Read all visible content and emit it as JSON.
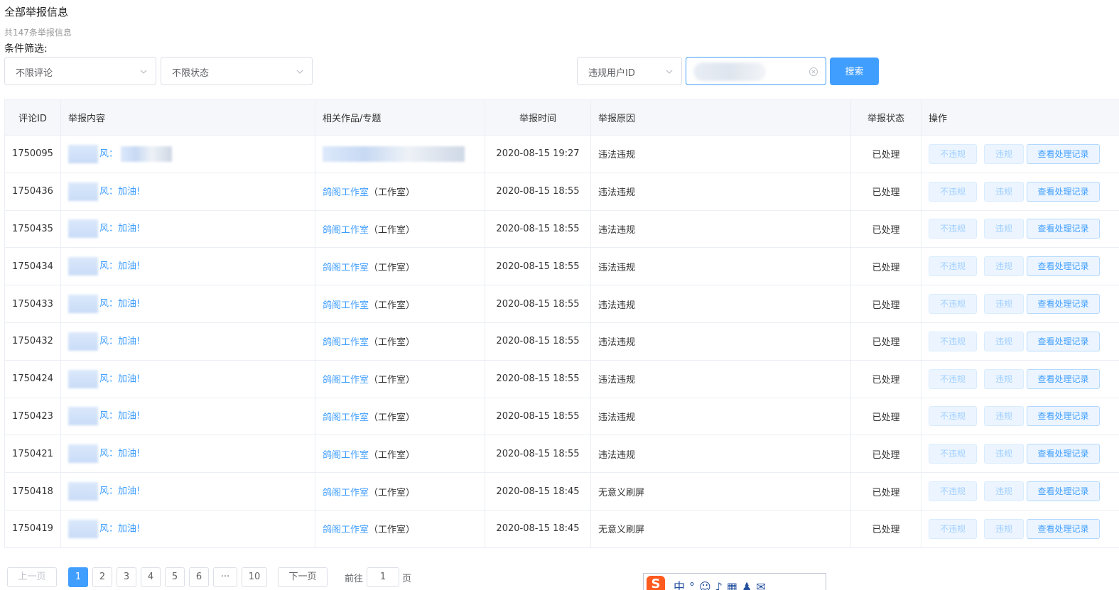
{
  "header": {
    "title": "全部举报信息",
    "count_text": "共147条举报信息",
    "filter_label": "条件筛选:"
  },
  "filters": {
    "comment_select": "不限评论",
    "status_select": "不限状态",
    "field_select": "违规用户ID",
    "search_button": "搜索"
  },
  "table": {
    "columns": [
      "评论ID",
      "举报内容",
      "相关作品/专题",
      "举报时间",
      "举报原因",
      "举报状态",
      "操作"
    ],
    "rows": [
      {
        "id": "1750095",
        "content_suffix": "风：",
        "work": "",
        "work_suffix": "",
        "time": "2020-08-15 19:27",
        "reason": "违法违规",
        "status": "已处理"
      },
      {
        "id": "1750436",
        "content_suffix": "风：加油!",
        "work": "鸽阁工作室",
        "work_suffix": "（工作室）",
        "time": "2020-08-15 18:55",
        "reason": "违法违规",
        "status": "已处理"
      },
      {
        "id": "1750435",
        "content_suffix": "风：加油!",
        "work": "鸽阁工作室",
        "work_suffix": "（工作室）",
        "time": "2020-08-15 18:55",
        "reason": "违法违规",
        "status": "已处理"
      },
      {
        "id": "1750434",
        "content_suffix": "风：加油!",
        "work": "鸽阁工作室",
        "work_suffix": "（工作室）",
        "time": "2020-08-15 18:55",
        "reason": "违法违规",
        "status": "已处理"
      },
      {
        "id": "1750433",
        "content_suffix": "风：加油!",
        "work": "鸽阁工作室",
        "work_suffix": "（工作室）",
        "time": "2020-08-15 18:55",
        "reason": "违法违规",
        "status": "已处理"
      },
      {
        "id": "1750432",
        "content_suffix": "风：加油!",
        "work": "鸽阁工作室",
        "work_suffix": "（工作室）",
        "time": "2020-08-15 18:55",
        "reason": "违法违规",
        "status": "已处理"
      },
      {
        "id": "1750424",
        "content_suffix": "风：加油!",
        "work": "鸽阁工作室",
        "work_suffix": "（工作室）",
        "time": "2020-08-15 18:55",
        "reason": "违法违规",
        "status": "已处理"
      },
      {
        "id": "1750423",
        "content_suffix": "风：加油!",
        "work": "鸽阁工作室",
        "work_suffix": "（工作室）",
        "time": "2020-08-15 18:55",
        "reason": "违法违规",
        "status": "已处理"
      },
      {
        "id": "1750421",
        "content_suffix": "风：加油!",
        "work": "鸽阁工作室",
        "work_suffix": "（工作室）",
        "time": "2020-08-15 18:55",
        "reason": "违法违规",
        "status": "已处理"
      },
      {
        "id": "1750418",
        "content_suffix": "风：加油!",
        "work": "鸽阁工作室",
        "work_suffix": "（工作室）",
        "time": "2020-08-15 18:45",
        "reason": "无意义刷屏",
        "status": "已处理"
      },
      {
        "id": "1750419",
        "content_suffix": "风：加油!",
        "work": "鸽阁工作室",
        "work_suffix": "（工作室）",
        "time": "2020-08-15 18:45",
        "reason": "无意义刷屏",
        "status": "已处理"
      }
    ],
    "actions": {
      "not_violation": "不违规",
      "violation": "违规",
      "view_record": "查看处理记录"
    }
  },
  "pagination": {
    "prev": "上一页",
    "pages": [
      "1",
      "2",
      "3",
      "4",
      "5",
      "6",
      "···",
      "10"
    ],
    "active_page": "1",
    "next": "下一页",
    "goto_label": "前往",
    "goto_value": "1",
    "page_suffix": "页"
  },
  "colors": {
    "primary": "#409eff",
    "header_bg": "#f5f7fa",
    "border": "#ebeef5"
  },
  "icons": {
    "select_arrow": "chevron-down-icon",
    "clear": "circle-close-icon"
  }
}
